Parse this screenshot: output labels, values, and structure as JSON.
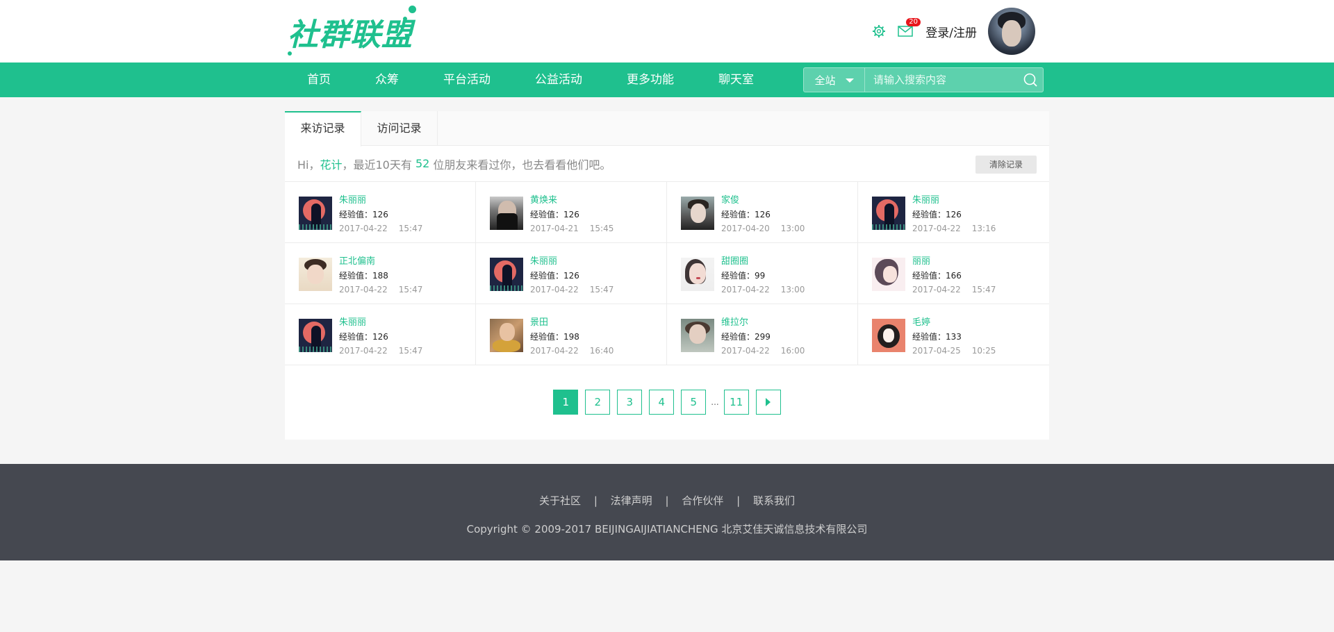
{
  "brand": {
    "logo_text": "社群联盟",
    "accent": "#1fc08e"
  },
  "header": {
    "mail_badge": "20",
    "login_label": "登录/注册"
  },
  "nav": {
    "items": [
      "首页",
      "众筹",
      "平台活动",
      "公益活动",
      "更多功能",
      "聊天室"
    ]
  },
  "search": {
    "scope": "全站",
    "placeholder": "请输入搜索内容"
  },
  "tabs": [
    "来访记录",
    "访问记录"
  ],
  "info": {
    "prefix": "Hi，",
    "user": "花计",
    "middle": "，最近10天有 ",
    "count": "52",
    "suffix": " 位朋友来看过你，也去看看他们吧。",
    "clear_label": "清除记录"
  },
  "visitors": [
    {
      "avatar": "a",
      "name": "朱丽丽",
      "exp": "经验值：126",
      "date": "2017-04-22",
      "time": "15:47"
    },
    {
      "avatar": "b",
      "name": "黄焕来",
      "exp": "经验值：126",
      "date": "2017-04-21",
      "time": "15:45"
    },
    {
      "avatar": "c",
      "name": "家俊",
      "exp": "经验值：126",
      "date": "2017-04-20",
      "time": "13:00"
    },
    {
      "avatar": "a",
      "name": "朱丽丽",
      "exp": "经验值：126",
      "date": "2017-04-22",
      "time": "13:16"
    },
    {
      "avatar": "d",
      "name": "正北偏南",
      "exp": "经验值：188",
      "date": "2017-04-22",
      "time": "15:47"
    },
    {
      "avatar": "a",
      "name": "朱丽丽",
      "exp": "经验值：126",
      "date": "2017-04-22",
      "time": "15:47"
    },
    {
      "avatar": "e",
      "name": "甜圈圈",
      "exp": "经验值：99",
      "date": "2017-04-22",
      "time": "13:00"
    },
    {
      "avatar": "f",
      "name": "丽丽",
      "exp": "经验值：166",
      "date": "2017-04-22",
      "time": "15:47"
    },
    {
      "avatar": "a",
      "name": "朱丽丽",
      "exp": "经验值：126",
      "date": "2017-04-22",
      "time": "15:47"
    },
    {
      "avatar": "g",
      "name": "景田",
      "exp": "经验值：198",
      "date": "2017-04-22",
      "time": "16:40"
    },
    {
      "avatar": "h",
      "name": "维拉尔",
      "exp": "经验值：299",
      "date": "2017-04-22",
      "time": "16:00"
    },
    {
      "avatar": "i",
      "name": "毛婷",
      "exp": "经验值：133",
      "date": "2017-04-25",
      "time": "10:25"
    }
  ],
  "pagination": {
    "pages": [
      "1",
      "2",
      "3",
      "4",
      "5"
    ],
    "ellipsis": "...",
    "last": "11",
    "current": "1"
  },
  "footer": {
    "links": [
      "关于社区",
      "法律声明",
      "合作伙伴",
      "联系我们"
    ],
    "separator": "|",
    "copyright": "Copyright © 2009-2017 BEIJINGAIJIATIANCHENG 北京艾佳天诚信息技术有限公司"
  }
}
